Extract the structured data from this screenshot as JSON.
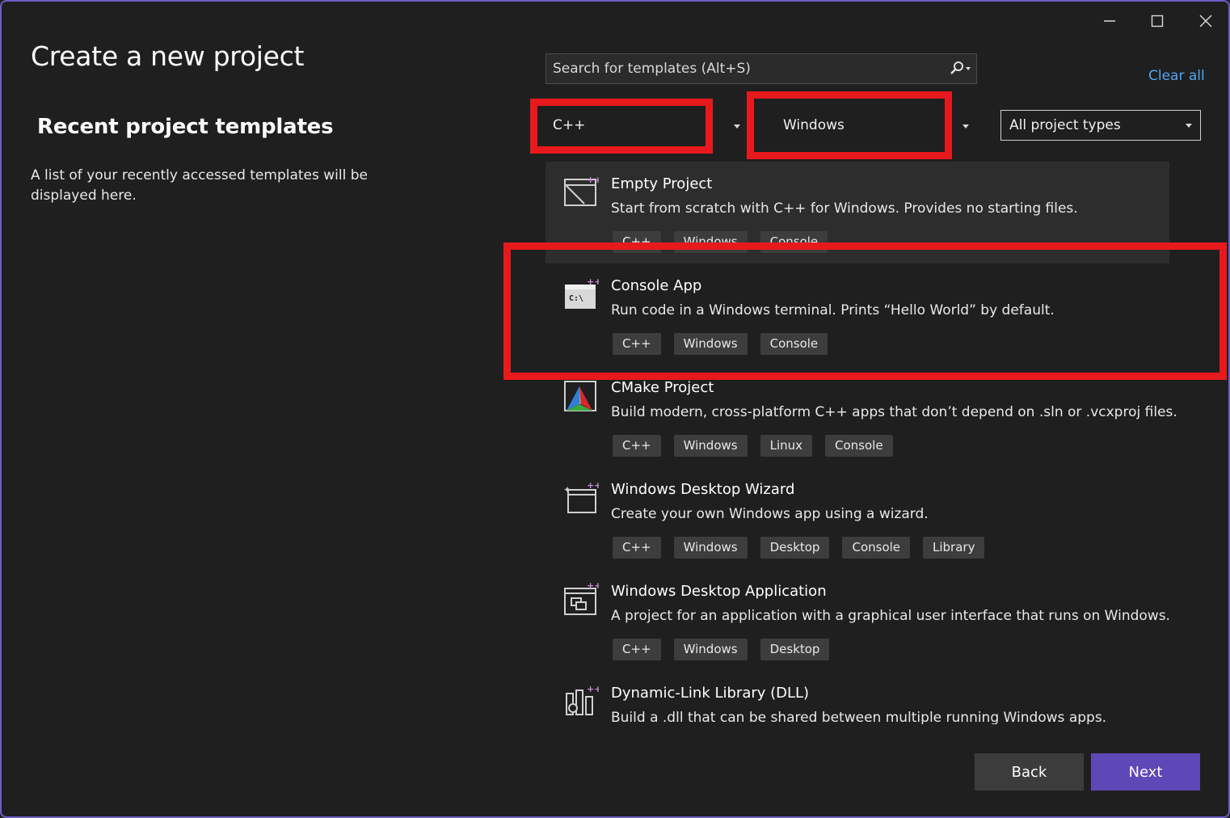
{
  "window": {
    "title": "Create a new project",
    "controls": {
      "minimize": "—",
      "maximize": "☐",
      "close": "✕"
    }
  },
  "recent": {
    "heading": "Recent project templates",
    "description": "A list of your recently accessed templates will be displayed here."
  },
  "search": {
    "placeholder": "Search for templates (Alt+S)",
    "value": ""
  },
  "clear_all": "Clear all",
  "filters": {
    "language": "C++",
    "platform": "Windows",
    "project_type": "All project types"
  },
  "templates": [
    {
      "name": "Empty Project",
      "description": "Start from scratch with C++ for Windows. Provides no starting files.",
      "tags": [
        "C++",
        "Windows",
        "Console"
      ],
      "icon": "empty-project-icon"
    },
    {
      "name": "Console App",
      "description": "Run code in a Windows terminal. Prints “Hello World” by default.",
      "tags": [
        "C++",
        "Windows",
        "Console"
      ],
      "icon": "console-app-icon"
    },
    {
      "name": "CMake Project",
      "description": "Build modern, cross-platform C++ apps that don’t depend on .sln or .vcxproj files.",
      "tags": [
        "C++",
        "Windows",
        "Linux",
        "Console"
      ],
      "icon": "cmake-icon"
    },
    {
      "name": "Windows Desktop Wizard",
      "description": "Create your own Windows app using a wizard.",
      "tags": [
        "C++",
        "Windows",
        "Desktop",
        "Console",
        "Library"
      ],
      "icon": "wizard-icon"
    },
    {
      "name": "Windows Desktop Application",
      "description": "A project for an application with a graphical user interface that runs on Windows.",
      "tags": [
        "C++",
        "Windows",
        "Desktop"
      ],
      "icon": "desktop-app-icon"
    },
    {
      "name": "Dynamic-Link Library (DLL)",
      "description": "Build a .dll that can be shared between multiple running Windows apps.",
      "tags": [],
      "icon": "dll-icon"
    }
  ],
  "buttons": {
    "back": "Back",
    "next": "Next"
  },
  "colors": {
    "background": "#1f1f1f",
    "accent": "#5e48b8",
    "link": "#4fa5f5",
    "highlight_box": "#e8191c"
  }
}
